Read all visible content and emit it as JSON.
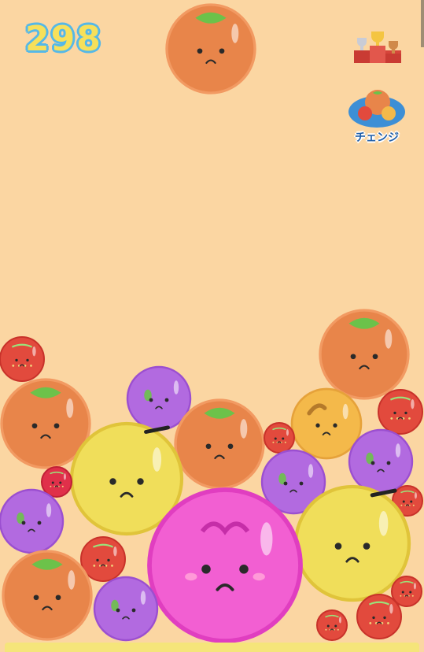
{
  "score": "298",
  "change_label": "チェンジ",
  "icons": {
    "ranking": "trophy-podium-icon",
    "change": "fruit-change-icon"
  },
  "colors": {
    "background": "#fbd6a2",
    "score_fill": "#f7e05a",
    "score_outline": "#55b8e8",
    "floor": "#f5e57a"
  },
  "fruits": {
    "next": {
      "type": "orange"
    },
    "pile": [
      {
        "type": "strawberry"
      },
      {
        "type": "orange"
      },
      {
        "type": "orange"
      },
      {
        "type": "grape"
      },
      {
        "type": "orange"
      },
      {
        "type": "persimmon"
      },
      {
        "type": "strawberry"
      },
      {
        "type": "strawberry"
      },
      {
        "type": "lemon"
      },
      {
        "type": "cherry"
      },
      {
        "type": "grape"
      },
      {
        "type": "grape"
      },
      {
        "type": "strawberry"
      },
      {
        "type": "grape"
      },
      {
        "type": "lemon"
      },
      {
        "type": "strawberry"
      },
      {
        "type": "peach"
      },
      {
        "type": "orange"
      },
      {
        "type": "grape"
      },
      {
        "type": "strawberry"
      },
      {
        "type": "strawberry"
      },
      {
        "type": "strawberry"
      }
    ]
  }
}
